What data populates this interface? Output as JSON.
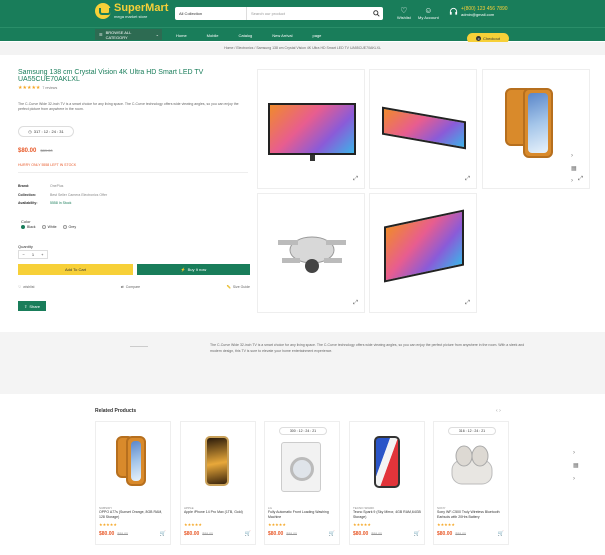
{
  "header": {
    "logo_name": "SuperMart",
    "logo_tagline": "mega market store",
    "search_category": "All Collection",
    "search_placeholder": "Search our product",
    "wishlist_label": "Wishlist",
    "account_label": "My Account",
    "phone": "+(800) 123 456 7890",
    "email": "admin@gmail.com"
  },
  "nav": {
    "browse_label": "BROWSE ALL CATEGORY",
    "links": [
      "Home",
      "Mobile",
      "Catalog",
      "New Arrival",
      "page"
    ],
    "checkout_label": "Checkout",
    "checkout_count": "0"
  },
  "breadcrumb": "Home  /  Electronics  /  Samsung 138 cm Crystal Vision 4K Ultra HD Smart LED TV UA55CUE70AKLXL",
  "product": {
    "title": "Samsung 138 cm Crystal Vision 4K Ultra HD Smart LED TV UA55CUE70AKLXL",
    "stars": "★★★★★",
    "reviews": "7 reviews",
    "description": "The C-Curve Wide 32-inch TV is a smart choice for any living space. The C-Curve technology offers wide viewing angles, so you can enjoy the perfect picture from anywhere in the room.",
    "timer": "317 : 12 : 24 : 31",
    "price": "$80.00",
    "old_price": "$89.00",
    "hurry": "HURRY ONLY  5558  LEFT IN STOCK",
    "specs": [
      {
        "k": "Brand:",
        "v": "OnePlus"
      },
      {
        "k": "Collection:",
        "v": "Best Seller Camera Electronics Offer"
      },
      {
        "k": "Availability:",
        "v": "5558 In Stock"
      }
    ],
    "color_label": "Color",
    "colors": [
      "Black",
      "White",
      "Grey"
    ],
    "quantity_label": "Quantity",
    "quantity": "1",
    "add_to_cart": "Add To Cart",
    "buy_now": "Buy It now",
    "wishlist": "wishlist",
    "compare": "Compare",
    "size_guide": "Size Guide",
    "share": "Share"
  },
  "band_text": "The C-Curve Wide 32-inch TV is a smart choice for any living space. The C-Curve technology offers wide viewing angles, so you can enjoy the perfect picture from anywhere in the room. With a sleek and modern design, this TV is sure to elevate your home entertainment experience.",
  "related": {
    "title": "Related Products",
    "items": [
      {
        "brand": "SUBSIDY",
        "name": "OPPO A77s (Sunset Orange, 8GB RAM, 128 Storage)",
        "price": "$80.00",
        "old": "$89.00"
      },
      {
        "brand": "APPLE",
        "name": "Apple iPhone 14 Pro Max (1TB, Gold)",
        "price": "$80.00",
        "old": "$89.00"
      },
      {
        "brand": "LG",
        "name": "Fully Automatic Front Loading Washing Machine",
        "timer": "300 : 12 : 24 : 21",
        "price": "$80.00",
        "old": "$89.00"
      },
      {
        "brand": "TECNO SPARK",
        "name": "Tecno Spark 9 (Sky Mirror, 4GB RAM,64GB Storage)",
        "price": "$80.00",
        "old": "$89.00"
      },
      {
        "brand": "SONY",
        "name": "Sony WF-C500 Truly Wireless Bluetooth Earbuds with 20Hrs Battery",
        "timer": "316 : 12 : 24 : 21",
        "price": "$80.00",
        "old": "$89.00"
      }
    ]
  },
  "colors": {
    "brand_green": "#197d5a",
    "accent_yellow": "#f7d038",
    "price_red": "#e85a2a"
  }
}
